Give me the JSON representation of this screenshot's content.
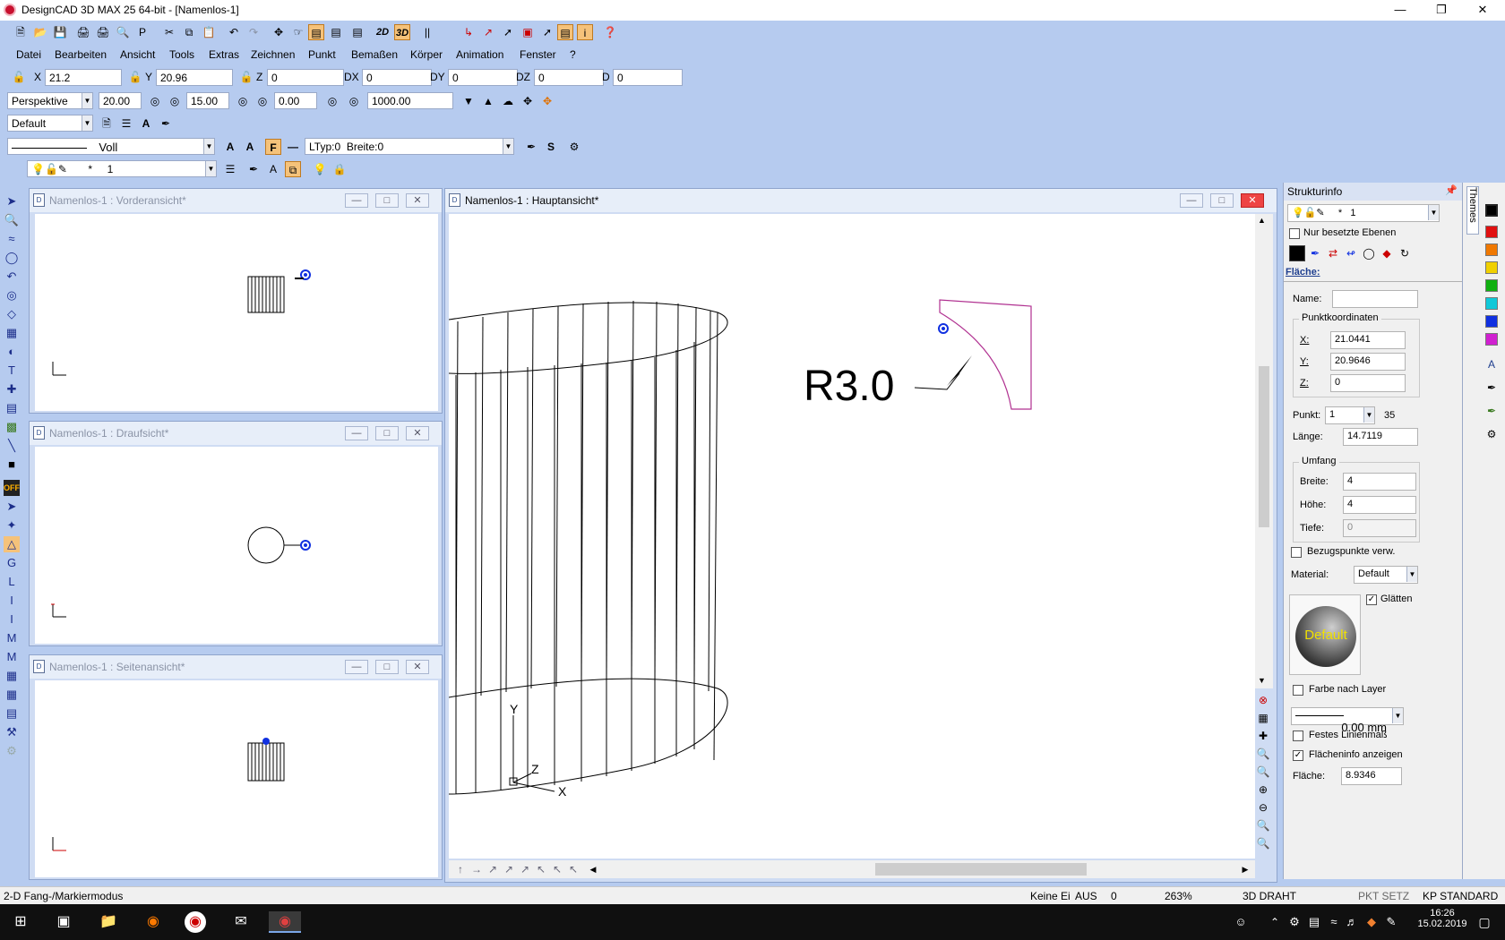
{
  "app": {
    "title": "DesignCAD 3D MAX 25 64-bit - [Namenlos-1]"
  },
  "menu": [
    "Datei",
    "Bearbeiten",
    "Ansicht",
    "Tools",
    "Extras",
    "Zeichnen",
    "Punkt",
    "Bemaßen",
    "Körper",
    "Animation",
    "Fenster",
    "?"
  ],
  "coords": {
    "x_label": "X",
    "x_value": "21.2",
    "y_label": "Y",
    "y_value": "20.96",
    "z_label": "Z",
    "z_value": "0",
    "dx_label": "DX",
    "dx_value": "0",
    "dy_label": "DY",
    "dy_value": "0",
    "dz_label": "DZ",
    "dz_value": "0",
    "d_label": "D",
    "d_value": "0"
  },
  "view_toolbar": {
    "projection": "Perspektive",
    "value1": "20.00",
    "value2": "15.00",
    "value3": "0.00",
    "value4": "1000.00",
    "mode_2d": "2D",
    "mode_3d": "3D"
  },
  "style_toolbar": {
    "style": "Default"
  },
  "line_toolbar": {
    "line_style": "Voll",
    "ltype": "LTyp:0",
    "width": "Breite:0",
    "fill_btn": "F"
  },
  "layer_toolbar": {
    "star": "*",
    "layer": "1"
  },
  "windows": {
    "front": "Namenlos-1 : Vorderansicht*",
    "top": "Namenlos-1 : Draufsicht*",
    "side": "Namenlos-1 : Seitenansicht*",
    "main": "Namenlos-1 : Hauptansicht*"
  },
  "drawing": {
    "dimension_text": "R3.0",
    "axis_x": "X",
    "axis_y": "Y",
    "axis_z": "Z"
  },
  "panel": {
    "title": "Strukturinfo",
    "tab_themes": "Themes",
    "layer_star": "*",
    "layer_value": "1",
    "only_used_layers": "Nur besetzte Ebenen",
    "section_title": "Fläche:",
    "name_label": "Name:",
    "name_value": "",
    "point_coords_group": "Punktkoordinaten",
    "x_label": "X:",
    "x_value": "21.0441",
    "y_label": "Y:",
    "y_value": "20.9646",
    "z_label": "Z:",
    "z_value": "0",
    "point_label": "Punkt:",
    "point_value": "1",
    "point_count": "35",
    "length_label": "Länge:",
    "length_value": "14.7119",
    "extent_group": "Umfang",
    "width_label": "Breite:",
    "width_value": "4",
    "height_label": "Höhe:",
    "height_value": "4",
    "depth_label": "Tiefe:",
    "depth_value": "0",
    "ref_points": "Bezugspunkte verw.",
    "material_label": "Material:",
    "material_value": "Default",
    "smooth_label": "Glätten",
    "sphere_label": "Default",
    "color_by_layer": "Farbe nach Layer",
    "line_width_value": "0.00 mm",
    "fixed_line": "Festes Linienmaß",
    "show_area_info": "Flächeninfo anzeigen",
    "area_label": "Fläche:",
    "area_value": "8.9346"
  },
  "colors": [
    "#000000",
    "#e01010",
    "#f07800",
    "#f0d000",
    "#10b010",
    "#10c8d8",
    "#1030e0",
    "#d020d0"
  ],
  "status": {
    "mode": "2-D Fang-/Markiermodus",
    "keine": "Keine Ei",
    "aus": "AUS",
    "zero": "0",
    "zoom": "263%",
    "view_mode": "3D DRAHT",
    "pkt": "PKT SETZ",
    "kp": "KP STANDARD"
  },
  "taskbar": {
    "time": "16:26",
    "date": "15.02.2019"
  }
}
